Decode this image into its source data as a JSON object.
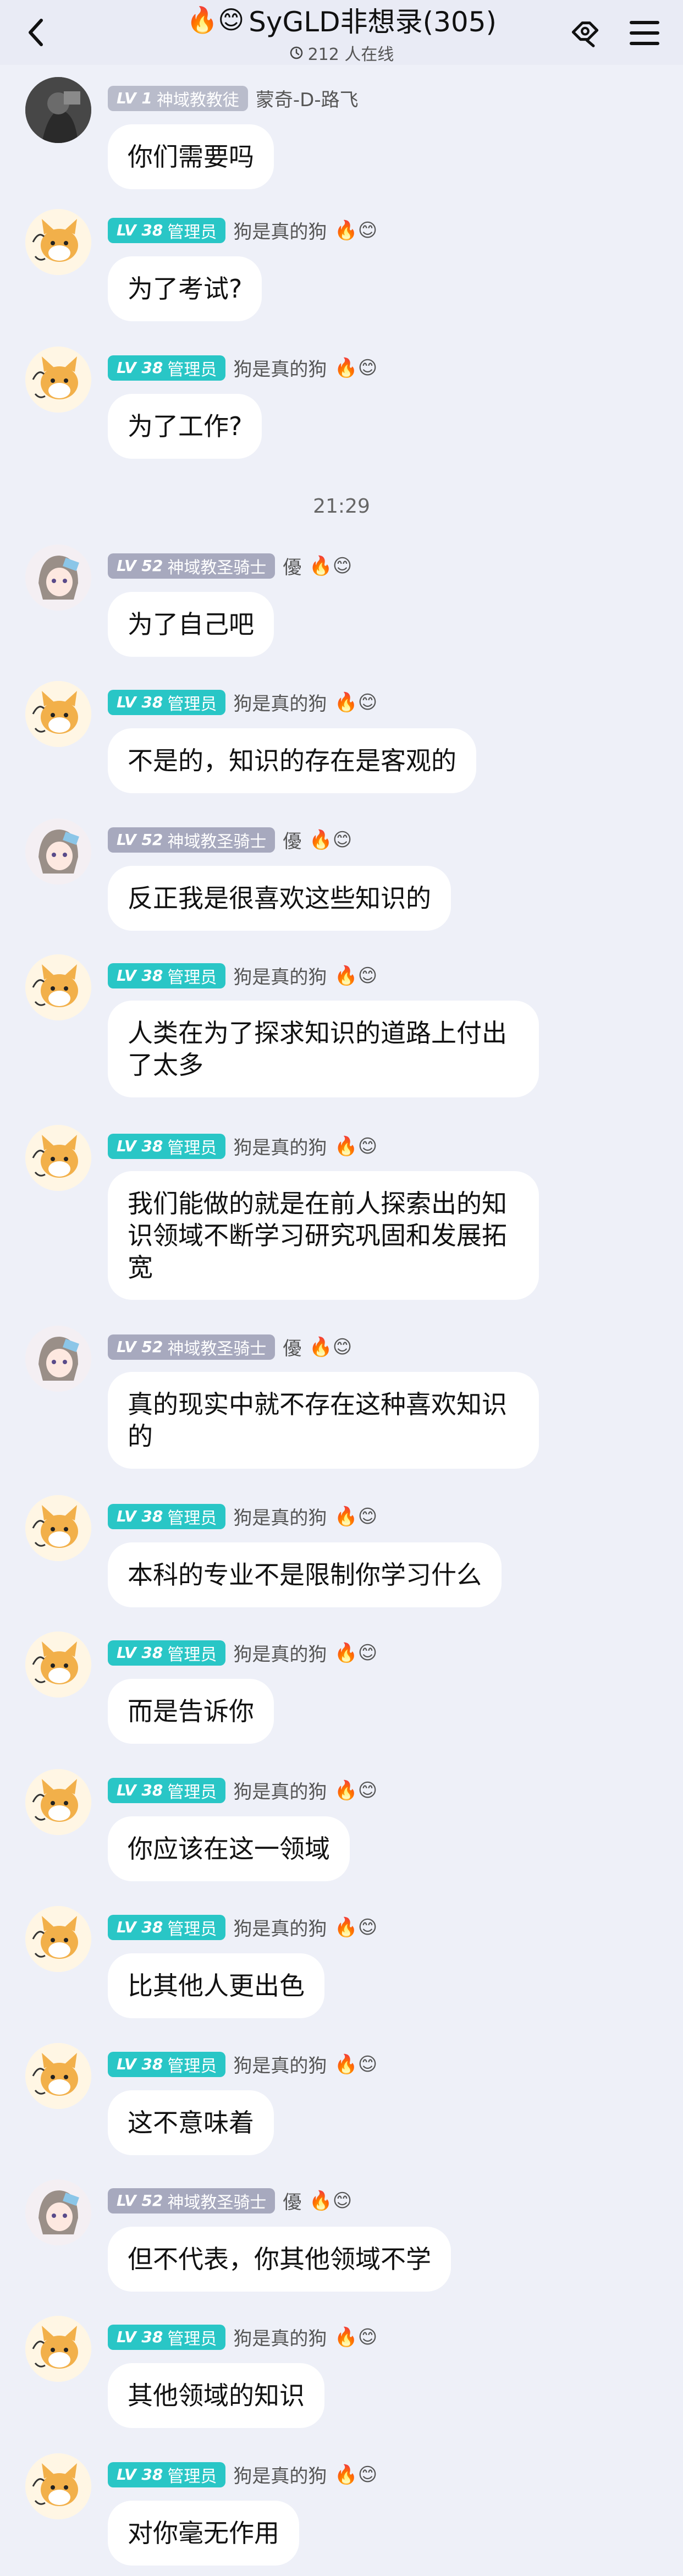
{
  "header": {
    "title_emojis": "🔥😊",
    "title": "SyGLD非想录(305)",
    "online": "212 人在线"
  },
  "messages": [
    {
      "avatar": "dark",
      "badge_lv": "LV 1",
      "badge_title": "神域教教徒",
      "badge_type": "believer",
      "name": "蒙奇-D-路飞",
      "flair": "",
      "text": "你们需要吗"
    },
    {
      "avatar": "dog",
      "badge_lv": "LV 38",
      "badge_title": "管理员",
      "badge_type": "admin",
      "name": "狗是真的狗",
      "flair": "🔥😊",
      "text": "为了考试?"
    },
    {
      "avatar": "dog",
      "badge_lv": "LV 38",
      "badge_title": "管理员",
      "badge_type": "admin",
      "name": "狗是真的狗",
      "flair": "🔥😊",
      "text": "为了工作?"
    },
    {
      "avatar": "girl",
      "badge_lv": "LV 52",
      "badge_title": "神域教圣骑士",
      "badge_type": "knight",
      "name": "優",
      "flair": "🔥😊",
      "text": "为了自己吧"
    },
    {
      "avatar": "dog",
      "badge_lv": "LV 38",
      "badge_title": "管理员",
      "badge_type": "admin",
      "name": "狗是真的狗",
      "flair": "🔥😊",
      "text": "不是的，知识的存在是客观的"
    },
    {
      "avatar": "girl",
      "badge_lv": "LV 52",
      "badge_title": "神域教圣骑士",
      "badge_type": "knight",
      "name": "優",
      "flair": "🔥😊",
      "text": "反正我是很喜欢这些知识的"
    },
    {
      "avatar": "dog",
      "badge_lv": "LV 38",
      "badge_title": "管理员",
      "badge_type": "admin",
      "name": "狗是真的狗",
      "flair": "🔥😊",
      "text": "人类在为了探求知识的道路上付出了太多"
    },
    {
      "avatar": "dog",
      "badge_lv": "LV 38",
      "badge_title": "管理员",
      "badge_type": "admin",
      "name": "狗是真的狗",
      "flair": "🔥😊",
      "text": "我们能做的就是在前人探索出的知识领域不断学习研究巩固和发展拓宽"
    },
    {
      "avatar": "girl",
      "badge_lv": "LV 52",
      "badge_title": "神域教圣骑士",
      "badge_type": "knight",
      "name": "優",
      "flair": "🔥😊",
      "text": "真的现实中就不存在这种喜欢知识的"
    },
    {
      "avatar": "dog",
      "badge_lv": "LV 38",
      "badge_title": "管理员",
      "badge_type": "admin",
      "name": "狗是真的狗",
      "flair": "🔥😊",
      "text": "本科的专业不是限制你学习什么"
    },
    {
      "avatar": "dog",
      "badge_lv": "LV 38",
      "badge_title": "管理员",
      "badge_type": "admin",
      "name": "狗是真的狗",
      "flair": "🔥😊",
      "text": "而是告诉你"
    },
    {
      "avatar": "dog",
      "badge_lv": "LV 38",
      "badge_title": "管理员",
      "badge_type": "admin",
      "name": "狗是真的狗",
      "flair": "🔥😊",
      "text": "你应该在这一领域"
    },
    {
      "avatar": "dog",
      "badge_lv": "LV 38",
      "badge_title": "管理员",
      "badge_type": "admin",
      "name": "狗是真的狗",
      "flair": "🔥😊",
      "text": "比其他人更出色"
    },
    {
      "avatar": "dog",
      "badge_lv": "LV 38",
      "badge_title": "管理员",
      "badge_type": "admin",
      "name": "狗是真的狗",
      "flair": "🔥😊",
      "text": "这不意味着"
    },
    {
      "avatar": "girl",
      "badge_lv": "LV 52",
      "badge_title": "神域教圣骑士",
      "badge_type": "knight",
      "name": "優",
      "flair": "🔥😊",
      "text": "但不代表，你其他领域不学"
    },
    {
      "avatar": "dog",
      "badge_lv": "LV 38",
      "badge_title": "管理员",
      "badge_type": "admin",
      "name": "狗是真的狗",
      "flair": "🔥😊",
      "text": "其他领域的知识"
    },
    {
      "avatar": "dog",
      "badge_lv": "LV 38",
      "badge_title": "管理员",
      "badge_type": "admin",
      "name": "狗是真的狗",
      "flair": "🔥😊",
      "text": "对你毫无作用"
    }
  ],
  "timestamp": {
    "text": "21:29"
  },
  "icons": {
    "back": "chevron-left-icon",
    "share": "share-icon",
    "menu": "menu-icon",
    "clock": "clock-icon"
  }
}
